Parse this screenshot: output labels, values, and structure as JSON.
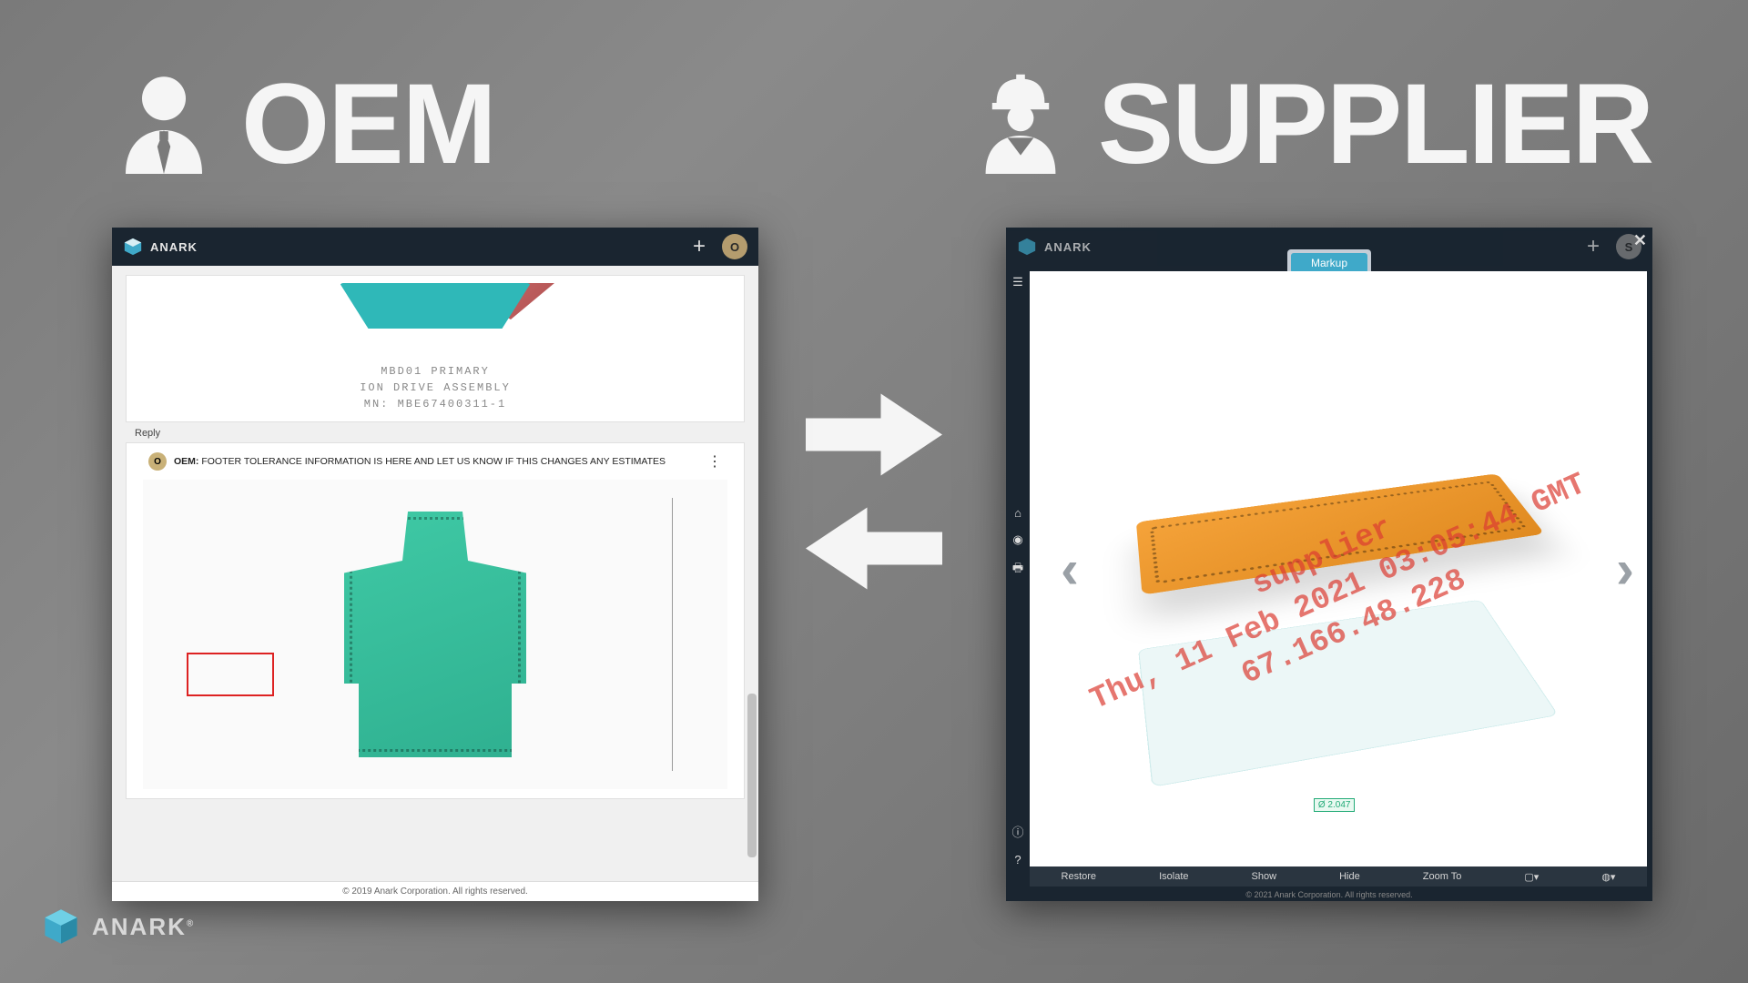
{
  "headers": {
    "oem": "OEM",
    "supplier": "SUPPLIER"
  },
  "brand": {
    "name": "ANARK",
    "reg": "®"
  },
  "oem_panel": {
    "app_name": "ANARK",
    "avatar": "O",
    "dwg_label1": "MBD01 PRIMARY",
    "dwg_label2": "ION DRIVE ASSEMBLY",
    "dwg_label3": "MN: MBE67400311-1",
    "reply": "Reply",
    "comment_author": "OEM:",
    "comment_text": "FOOTER TOLERANCE INFORMATION IS HERE AND LET US KNOW IF THIS CHANGES ANY ESTIMATES",
    "footer": "© 2019 Anark Corporation. All rights reserved."
  },
  "sup_panel": {
    "app_name": "ANARK",
    "avatar": "S",
    "markup": "Markup",
    "watermark": "supplier\nThu, 11 Feb 2021 03:05:44 GMT\n67.166.48.228",
    "bottom": {
      "restore": "Restore",
      "isolate": "Isolate",
      "show": "Show",
      "hide": "Hide",
      "zoom": "Zoom To"
    },
    "dim1": "Ø 2.047",
    "footer": "© 2021 Anark Corporation. All rights reserved."
  }
}
